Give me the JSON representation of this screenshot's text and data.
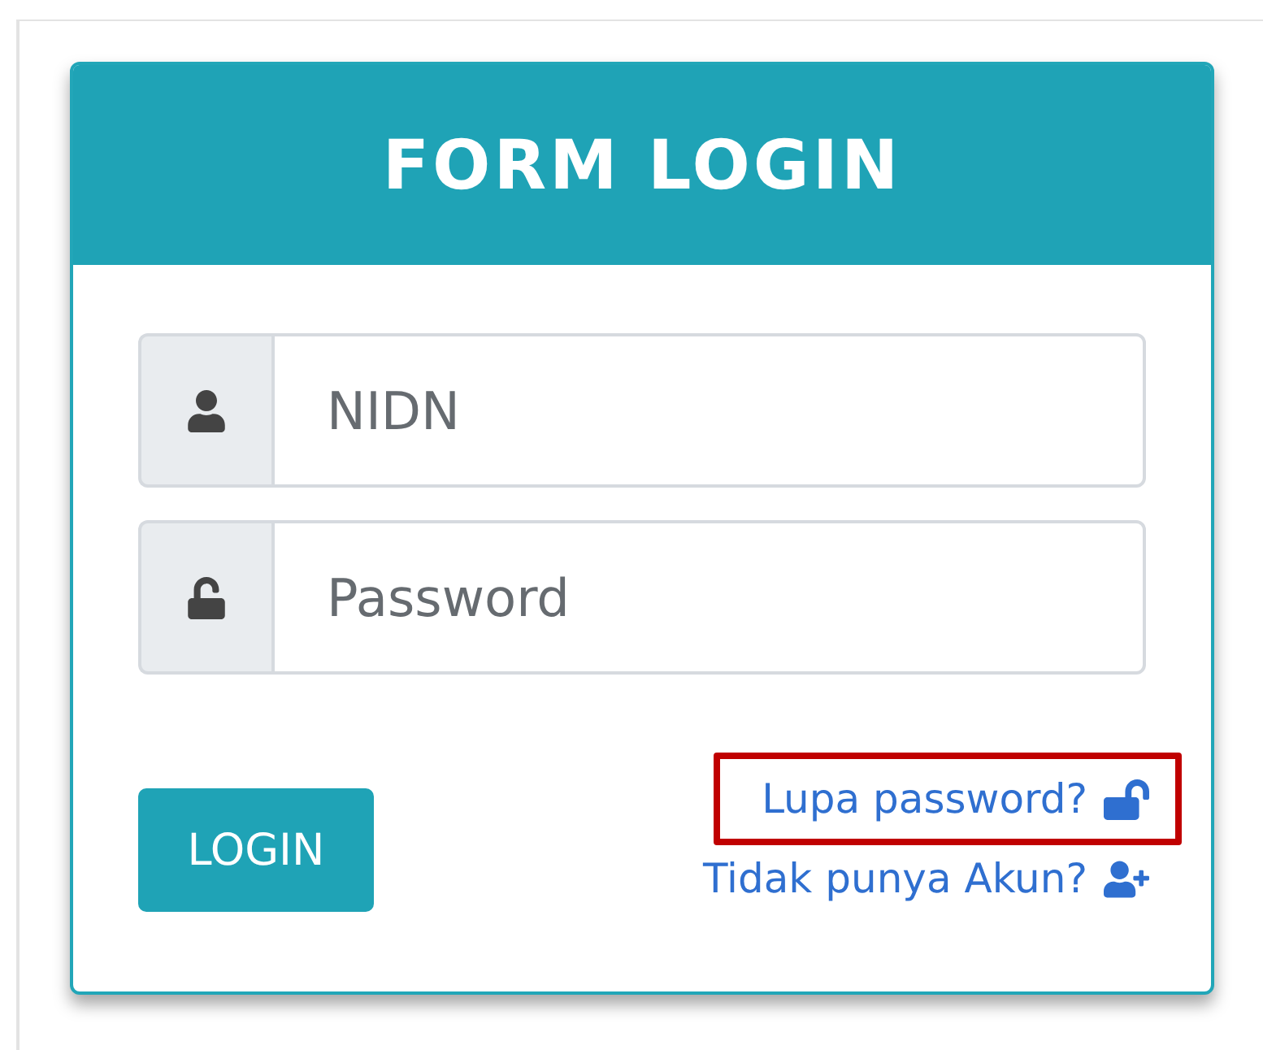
{
  "card": {
    "title": "FORM LOGIN"
  },
  "fields": [
    {
      "kind": "user",
      "placeholder": "NIDN"
    },
    {
      "kind": "lock",
      "placeholder": "Password"
    }
  ],
  "login_button": "LOGIN",
  "links": [
    {
      "kind": "forgot",
      "text": "Lupa password?",
      "highlighted": true
    },
    {
      "kind": "register",
      "text": "Tidak punya Akun?",
      "highlighted": false
    }
  ]
}
